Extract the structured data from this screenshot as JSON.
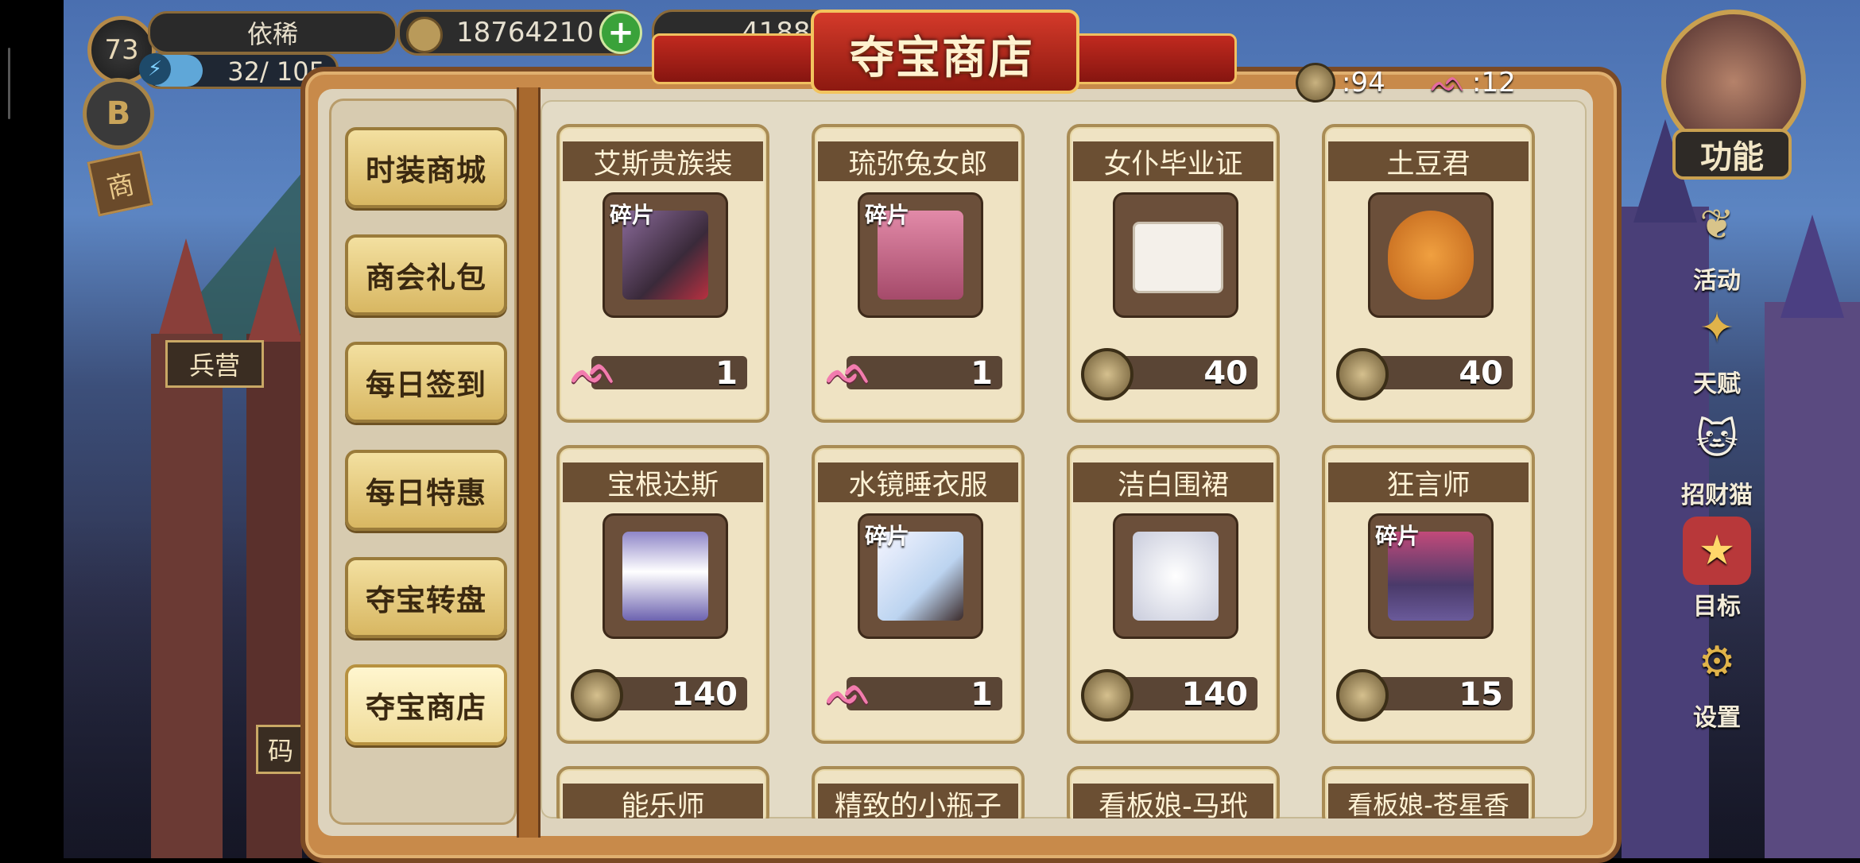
{
  "hud": {
    "level": "73",
    "player_name": "依稀",
    "energy_text": "32/ 105",
    "energy_fraction": 0.3,
    "gold": "18764210",
    "gems": "4188"
  },
  "map_signs": {
    "barracks": "兵营",
    "partial": "码"
  },
  "shop": {
    "title": "夺宝商店",
    "coin_count": ":94",
    "bunny_count": ":12"
  },
  "nav": [
    {
      "label": "时装商城"
    },
    {
      "label": "商会礼包"
    },
    {
      "label": "每日签到"
    },
    {
      "label": "每日特惠"
    },
    {
      "label": "夺宝转盘"
    },
    {
      "label": "夺宝商店",
      "active": true
    }
  ],
  "items": [
    {
      "name": "艾斯贵族装",
      "fragment": "碎片",
      "currency": "bunny",
      "price": "1"
    },
    {
      "name": "琉弥兔女郎",
      "fragment": "碎片",
      "currency": "bunny",
      "price": "1"
    },
    {
      "name": "女仆毕业证",
      "fragment": "",
      "currency": "coin",
      "price": "40"
    },
    {
      "name": "土豆君",
      "fragment": "",
      "currency": "coin",
      "price": "40"
    },
    {
      "name": "宝根达斯",
      "fragment": "",
      "currency": "coin",
      "price": "140"
    },
    {
      "name": "水镜睡衣服",
      "fragment": "碎片",
      "currency": "bunny",
      "price": "1"
    },
    {
      "name": "洁白围裙",
      "fragment": "",
      "currency": "coin",
      "price": "140"
    },
    {
      "name": "狂言师",
      "fragment": "碎片",
      "currency": "coin",
      "price": "15"
    },
    {
      "name": "能乐师"
    },
    {
      "name": "精致的小瓶子"
    },
    {
      "name": "看板娘-马玳"
    },
    {
      "name": "看板娘-苍星香"
    }
  ],
  "side_menu": {
    "function_label": "功能",
    "activity": "活动",
    "talent": "天赋",
    "lucky_cat": "招财猫",
    "goal": "目标",
    "settings": "设置"
  },
  "colors": {
    "accent_red": "#c12a1f",
    "card_bg": "#efe3c3",
    "nav_gold": "#d8b762"
  }
}
